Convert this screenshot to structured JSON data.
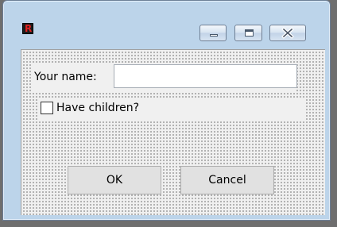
{
  "window": {
    "title": "",
    "icon": "app-r-icon",
    "icon_letter": "R",
    "controls": {
      "minimize": "minimize-icon",
      "maximize": "maximize-icon",
      "close": "close-icon"
    }
  },
  "form": {
    "name_label": "Your name:",
    "name_value": "",
    "children_label": "Have children?",
    "children_checked": false
  },
  "buttons": {
    "ok_label": "OK",
    "cancel_label": "Cancel"
  },
  "colors": {
    "frame": "#bcd4ea",
    "client": "#f0f0f0",
    "icon_red": "#e02020"
  }
}
